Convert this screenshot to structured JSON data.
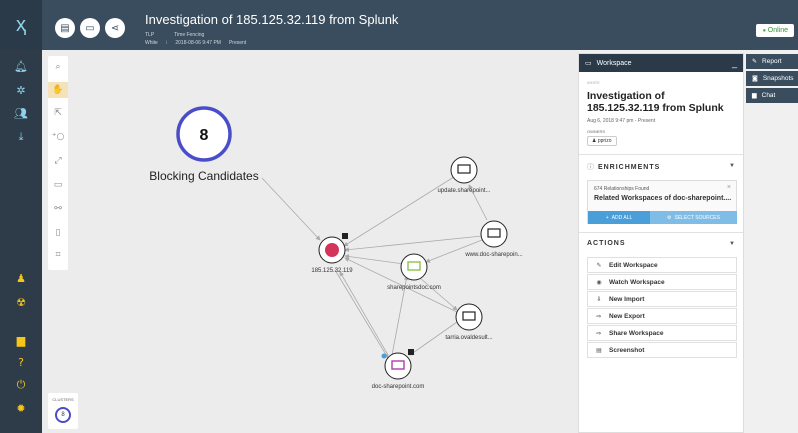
{
  "app": {
    "logo": "ҳ"
  },
  "header": {
    "title": "Investigation of 185.125.32.119 from Splunk",
    "meta_keys": [
      "TLP",
      "Time Fencing"
    ],
    "meta_vals": [
      "White",
      "⁝",
      "2018-08-06 9:47 PM",
      "Present"
    ],
    "status": "Online"
  },
  "toolbar": {
    "buttons": [
      "toggle-view",
      "present",
      "share"
    ]
  },
  "sidebar": {
    "icons": [
      "notifications-icon",
      "graph-icon",
      "users-icon",
      "download-icon",
      "person-icon",
      "radiation-icon",
      "chat-icon",
      "help-icon",
      "power-icon",
      "user-avatar"
    ]
  },
  "graph": {
    "blocking_count": "8",
    "blocking_label": "Blocking Candidates",
    "nodes": [
      {
        "label": "185.125.32.119"
      },
      {
        "label": "update.sharepoint..."
      },
      {
        "label": "www.doc-sharepoin..."
      },
      {
        "label": "sharepointsdoc.com"
      },
      {
        "label": "tarria.ovaldesult..."
      },
      {
        "label": "doc-sharepoint.com"
      }
    ],
    "clusters_label": "CLUSTERS",
    "clusters_count": "8"
  },
  "panel": {
    "header_title": "Workspace",
    "ws_label": "WHITE",
    "ws_title": "Investigation of 185.125.32.119 from Splunk",
    "ws_date": "Aug 6, 2018 9:47 pm - Present",
    "owners_label": "OWNERS",
    "owner": "pprizo",
    "enrichments_title": "ENRICHMENTS",
    "enrichment_count": "674 Relationships Found",
    "enrichment_text": "Related Workspaces of doc-sharepoint....",
    "add_all": "ADD ALL",
    "select_sources": "SELECT SOURCES",
    "actions_title": "ACTIONS",
    "actions": [
      "Edit Workspace",
      "Watch Workspace",
      "New Import",
      "New Export",
      "Share Workspace",
      "Screenshot"
    ]
  },
  "right_tabs": [
    "Report",
    "Snapshots",
    "Chat"
  ],
  "colors": {
    "topbar": "#3a4d5e",
    "sidebar": "#2e3c4a",
    "accent": "#4a4dc9",
    "node_red": "#d4335a",
    "node_green": "#8bc34a",
    "node_purple": "#b03ab0"
  }
}
